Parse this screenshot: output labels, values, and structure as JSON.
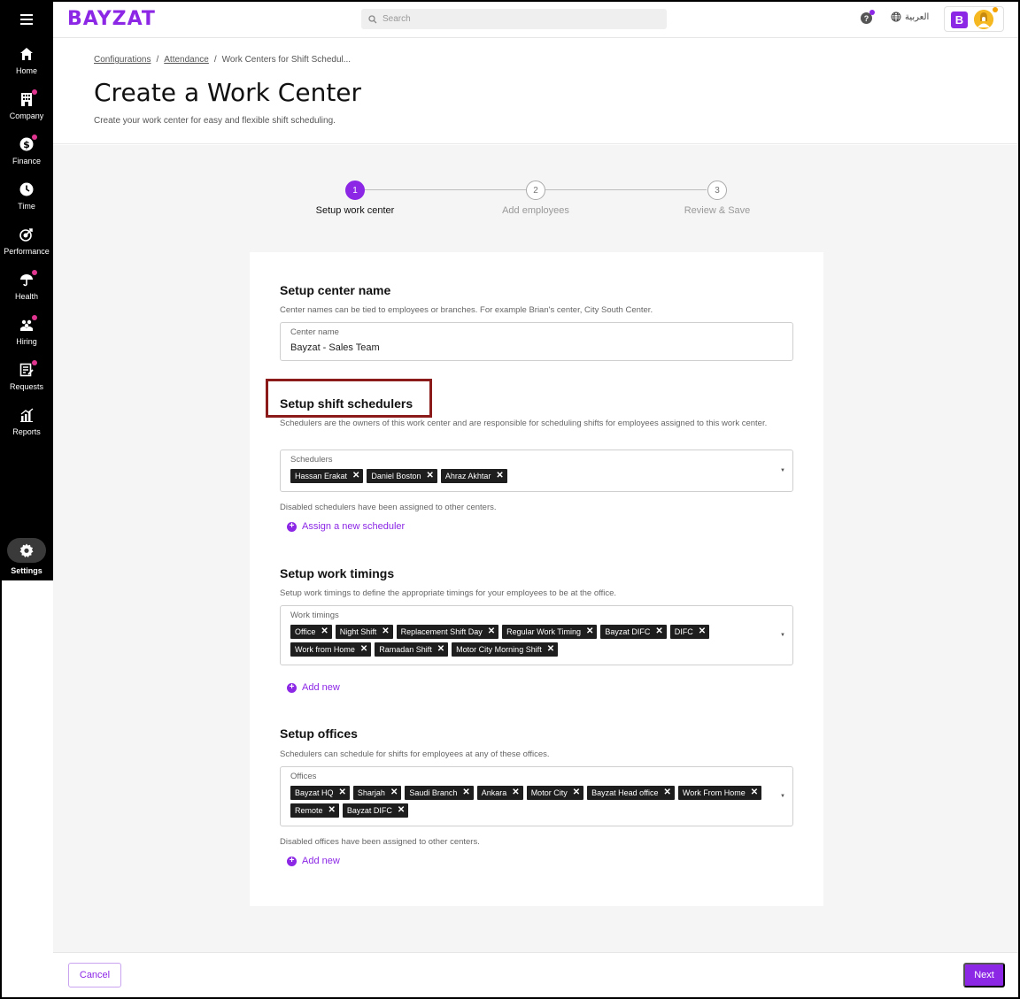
{
  "brand": {
    "logo": "BAYZAT",
    "accent": "#8c27e6"
  },
  "topbar": {
    "search_placeholder": "Search",
    "help_icon": "?",
    "language": "العربية",
    "account_initial": "B"
  },
  "sidebar": {
    "items": [
      {
        "label": "Home",
        "icon": "home-icon"
      },
      {
        "label": "Company",
        "icon": "building-icon"
      },
      {
        "label": "Finance",
        "icon": "dollar-icon"
      },
      {
        "label": "Time",
        "icon": "clock-icon"
      },
      {
        "label": "Performance",
        "icon": "target-icon"
      },
      {
        "label": "Health",
        "icon": "umbrella-icon"
      },
      {
        "label": "Hiring",
        "icon": "people-icon"
      },
      {
        "label": "Requests",
        "icon": "request-icon"
      },
      {
        "label": "Reports",
        "icon": "chart-icon"
      }
    ],
    "settings": "Settings"
  },
  "breadcrumb": {
    "c1": "Configurations",
    "c2": "Attendance",
    "c3": "Work Centers for Shift Schedul..."
  },
  "page": {
    "title": "Create a Work Center",
    "subtitle": "Create your work center for easy and flexible shift scheduling."
  },
  "stepper": {
    "steps": [
      {
        "num": "1",
        "label": "Setup work center"
      },
      {
        "num": "2",
        "label": "Add employees"
      },
      {
        "num": "3",
        "label": "Review & Save"
      }
    ]
  },
  "center": {
    "title": "Setup center name",
    "desc": "Center names can be tied to employees or branches. For example Brian's center, City South Center.",
    "field_label": "Center name",
    "field_value": "Bayzat - Sales Team"
  },
  "schedulers": {
    "title": "Setup shift schedulers",
    "desc": "Schedulers are the owners of this work center and are responsible for scheduling shifts for employees assigned to this work center.",
    "field_label": "Schedulers",
    "chips": [
      "Hassan Erakat",
      "Daniel Boston",
      "Ahraz Akhtar"
    ],
    "note": "Disabled schedulers have been assigned to other centers.",
    "add_label": "Assign a new scheduler"
  },
  "timings": {
    "title": "Setup work timings",
    "desc": "Setup work timings to define the appropriate timings for your employees to be at the office.",
    "field_label": "Work timings",
    "chips": [
      "Office",
      "Night Shift",
      "Replacement Shift Day",
      "Regular Work Timing",
      "Bayzat DIFC",
      "DIFC",
      "Work from Home",
      "Ramadan Shift",
      "Motor City Morning Shift"
    ],
    "add_label": "Add new"
  },
  "offices": {
    "title": "Setup offices",
    "desc": "Schedulers can schedule for shifts for employees at any of these offices.",
    "field_label": "Offices",
    "chips": [
      "Bayzat HQ",
      "Sharjah",
      "Saudi Branch",
      "Ankara",
      "Motor City",
      "Bayzat Head office",
      "Work From Home",
      "Remote",
      "Bayzat DIFC"
    ],
    "note": "Disabled offices have been assigned to other centers.",
    "add_label": "Add new"
  },
  "footer": {
    "cancel": "Cancel",
    "next": "Next"
  }
}
